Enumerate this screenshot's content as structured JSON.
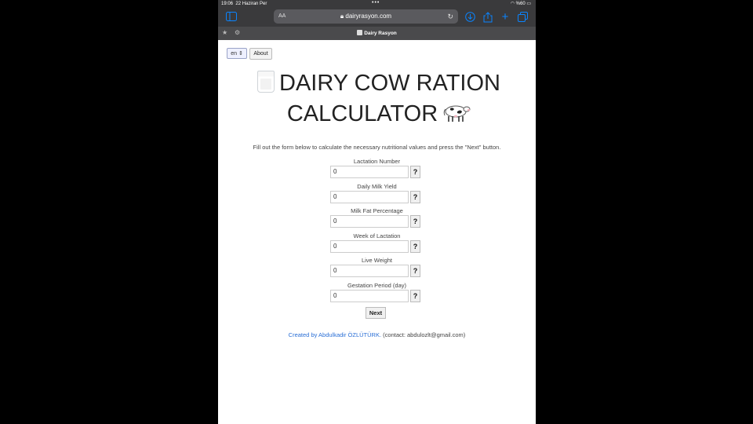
{
  "status_bar": {
    "time": "19:06",
    "date": "22 Haziran Per",
    "battery": "%60"
  },
  "browser": {
    "aa_label": "AA",
    "url": "dairyrasyon.com",
    "tab_title": "Dairy Rasyon"
  },
  "page": {
    "lang_selected": "en",
    "about_label": "About",
    "title": "DAIRY COW RATION CALCULATOR",
    "instruction": "Fill out the form below to calculate the necessary nutritional values and press the \"Next\" button.",
    "fields": [
      {
        "label": "Lactation Number",
        "value": "0",
        "help": "?"
      },
      {
        "label": "Daily Milk Yield",
        "value": "0",
        "help": "?"
      },
      {
        "label": "Milk Fat Percentage",
        "value": "0",
        "help": "?"
      },
      {
        "label": "Week of Lactation",
        "value": "0",
        "help": "?"
      },
      {
        "label": "Live Weight",
        "value": "0",
        "help": "?"
      },
      {
        "label": "Gestation Period (day)",
        "value": "0",
        "help": "?"
      }
    ],
    "next_label": "Next",
    "footer": {
      "link_text": "Created by Abdulkadir ÖZLÜTÜRK.",
      "contact_text": " (contact: abdulozlt@gmail.com)"
    }
  },
  "colors": {
    "accent": "#0a84ff",
    "link": "#2a6fd6",
    "chrome": "#3a3a3c"
  }
}
